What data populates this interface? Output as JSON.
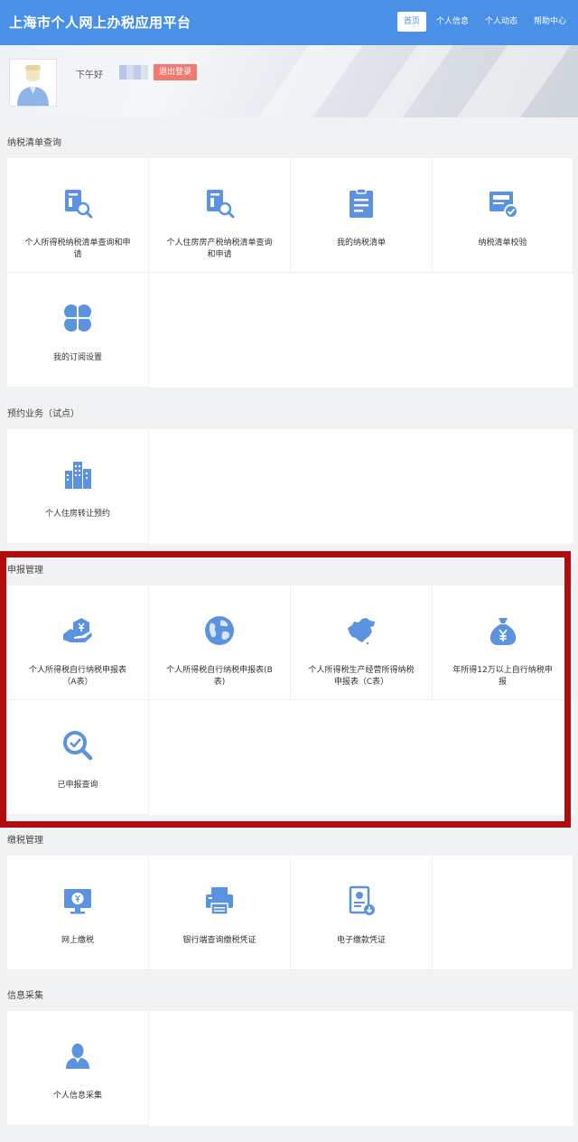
{
  "header": {
    "title": "上海市个人网上办税应用平台",
    "nav": [
      "首页",
      "个人信息",
      "个人动态",
      "帮助中心"
    ],
    "active_nav": 0,
    "brand_color": "#4a90e6"
  },
  "user": {
    "greeting": "下午好",
    "logout_label": "退出登录"
  },
  "sections": [
    {
      "title": "纳税清单查询",
      "items": [
        {
          "label": "个人所得税纳税清单查询和申请",
          "icon": "document-search-icon"
        },
        {
          "label": "个人住房房产税纳税清单查询和申请",
          "icon": "document-search-icon"
        },
        {
          "label": "我的纳税清单",
          "icon": "clipboard-list-icon"
        },
        {
          "label": "纳税清单校验",
          "icon": "verify-check-icon"
        },
        {
          "label": "我的订阅设置",
          "icon": "clover-grid-icon"
        }
      ]
    },
    {
      "title": "预约业务（试点）",
      "items": [
        {
          "label": "个人住房转让预约",
          "icon": "buildings-icon"
        }
      ]
    },
    {
      "title": "申报管理",
      "items": [
        {
          "label": "个人所得税自行纳税申报表（A表）",
          "icon": "hand-coin-icon"
        },
        {
          "label": "个人所得税自行纳税申报表(B表)",
          "icon": "globe-icon"
        },
        {
          "label": "个人所得税生产经营所得纳税申报表（C表）",
          "icon": "china-map-icon"
        },
        {
          "label": "年所得12万以上自行纳税申报",
          "icon": "money-bag-icon"
        },
        {
          "label": "已申报查询",
          "icon": "search-check-icon"
        }
      ]
    },
    {
      "title": "缴税管理",
      "items": [
        {
          "label": "网上缴税",
          "icon": "monitor-yuan-icon"
        },
        {
          "label": "银行端查询缴税凭证",
          "icon": "printer-icon"
        },
        {
          "label": "电子缴款凭证",
          "icon": "certificate-icon"
        }
      ]
    },
    {
      "title": "信息采集",
      "items": [
        {
          "label": "个人信息采集",
          "icon": "person-icon"
        }
      ]
    }
  ]
}
